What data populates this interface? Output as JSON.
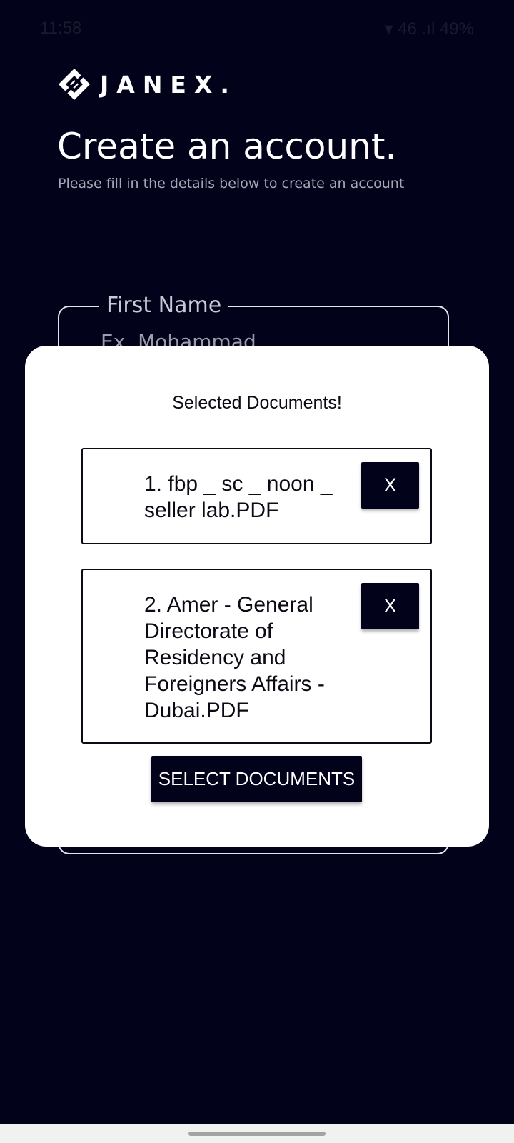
{
  "status_bar": {
    "time": "11:58",
    "indicators": "▾ 46 .ıl 49%"
  },
  "brand": {
    "name": "JANEX."
  },
  "header": {
    "title": "Create an account.",
    "subtitle": "Please fill in the details below to create an account"
  },
  "form": {
    "first_name": {
      "label": "First Name",
      "placeholder": "Ex. Mohammad"
    }
  },
  "modal": {
    "title": "Selected Documents!",
    "documents": [
      {
        "name": "1. fbp _ sc _ noon _ seller lab.PDF",
        "remove_label": "X"
      },
      {
        "name": "2. Amer - General Directorate of Residency and Foreigners Affairs - Dubai.PDF",
        "remove_label": "X"
      }
    ],
    "select_button_label": "SELECT DOCUMENTS"
  },
  "colors": {
    "background": "#03021b",
    "modal_background": "#ffffff",
    "button_background": "#03021b",
    "button_text": "#ffffff"
  }
}
